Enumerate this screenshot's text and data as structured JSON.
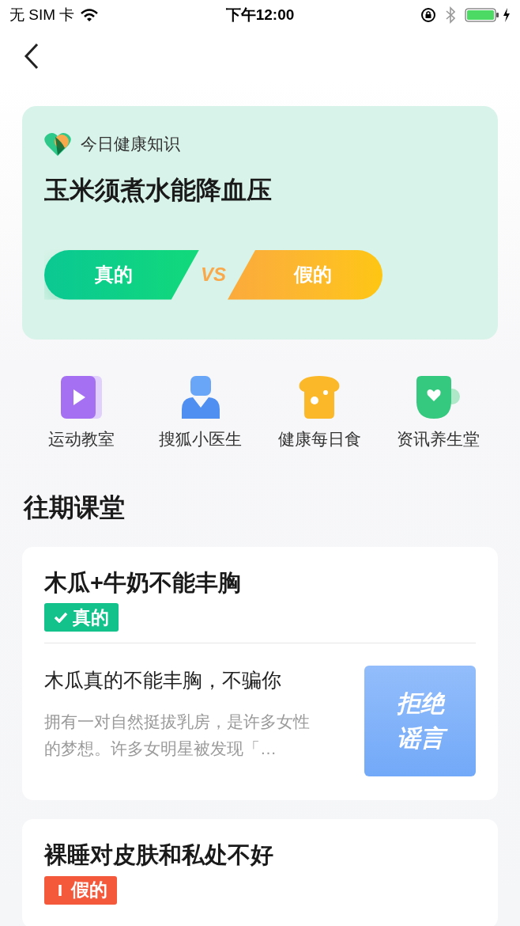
{
  "status_bar": {
    "carrier": "无 SIM 卡",
    "time": "下午12:00"
  },
  "daily": {
    "label": "今日健康知识",
    "question": "玉米须煮水能降血压",
    "true_button": "真的",
    "vs": "VS",
    "false_button": "假的"
  },
  "shortcuts": [
    {
      "label": "运动教室",
      "kind": "video"
    },
    {
      "label": "搜狐小医生",
      "kind": "doctor"
    },
    {
      "label": "健康每日食",
      "kind": "bread"
    },
    {
      "label": "资讯养生堂",
      "kind": "cup"
    }
  ],
  "section_title": "往期课堂",
  "lessons": [
    {
      "title": "木瓜+牛奶不能丰胸",
      "kind": "true",
      "badge": "真的",
      "article": {
        "title": "木瓜真的不能丰胸，不骗你",
        "summary": "拥有一对自然挺拔乳房，是许多女性的梦想。许多女明星被发现「…",
        "thumb_lines": [
          "拒绝",
          "谣言"
        ]
      }
    },
    {
      "title": "裸睡对皮肤和私处不好",
      "kind": "false",
      "badge": "假的"
    }
  ]
}
